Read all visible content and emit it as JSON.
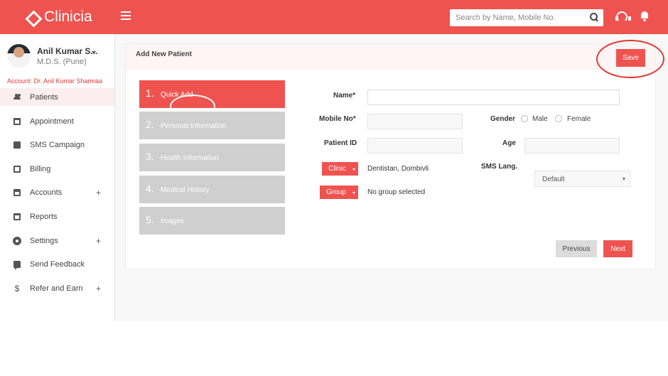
{
  "app": {
    "name": "Clinicia"
  },
  "search": {
    "placeholder": "Search by Name, Mobile No."
  },
  "user": {
    "name": "Anil Kumar S...",
    "degree": "M.D.S. (Pune)",
    "account": "Account: Dr. Anil Kumar Sharmaa"
  },
  "sidebar": {
    "items": [
      {
        "label": "Patients",
        "icon": "people-icon"
      },
      {
        "label": "Appointment",
        "icon": "calendar-icon"
      },
      {
        "label": "SMS Campaign",
        "icon": "mail-icon"
      },
      {
        "label": "Billing",
        "icon": "document-icon"
      },
      {
        "label": "Accounts",
        "icon": "card-icon",
        "expand": "+"
      },
      {
        "label": "Reports",
        "icon": "clipboard-icon"
      },
      {
        "label": "Settings",
        "icon": "gear-icon",
        "expand": "+"
      },
      {
        "label": "Send Feedback",
        "icon": "chat-icon"
      },
      {
        "label": "Refer and Earn",
        "icon": "dollar-icon",
        "expand": "+"
      }
    ]
  },
  "panel": {
    "title": "Add New Patient",
    "save_label": "Save"
  },
  "steps": [
    {
      "number": "1.",
      "label": "Quick Add"
    },
    {
      "number": "2.",
      "label": "Personal Information"
    },
    {
      "number": "3.",
      "label": "Health Information"
    },
    {
      "number": "4.",
      "label": "Medical History"
    },
    {
      "number": "5.",
      "label": "Images"
    }
  ],
  "form": {
    "name_label": "Name*",
    "mobile_label": "Mobile No*",
    "patient_id_label": "Patient ID",
    "gender_label": "Gender",
    "male_label": "Male",
    "female_label": "Female",
    "age_label": "Age",
    "clinic_button": "Clinic",
    "clinic_value": "Dentistan, Dombivli",
    "sms_lang_label": "SMS Lang.",
    "sms_lang_value": "Default",
    "group_button": "Group",
    "group_value": "No group selected",
    "previous_label": "Previous",
    "next_label": "Next"
  },
  "colors": {
    "brand": "#ef5350",
    "inactive_step": "#cfcfcf",
    "highlight_circle": "#e53935"
  }
}
